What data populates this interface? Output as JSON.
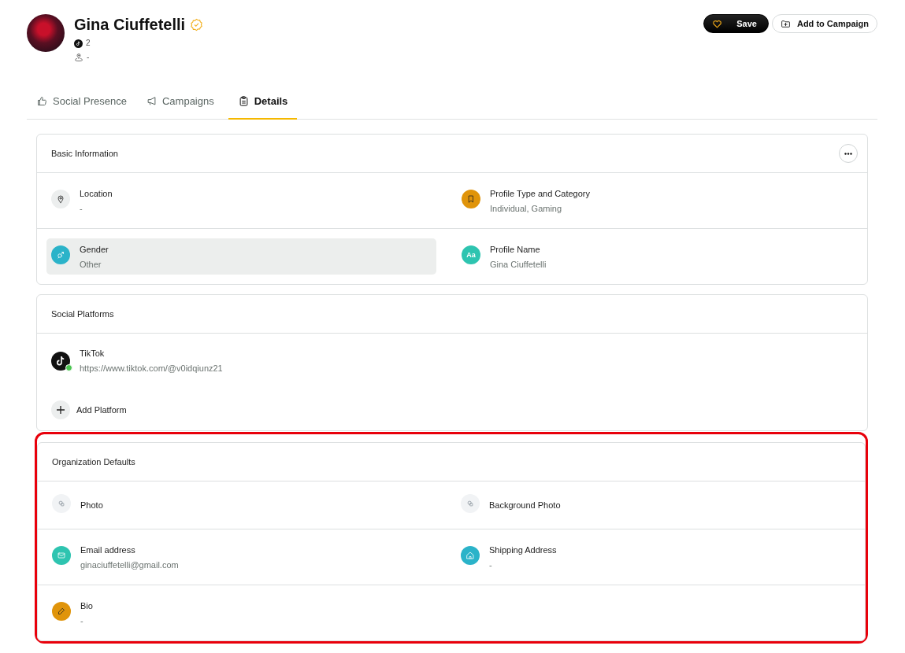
{
  "profile": {
    "name": "Gina Ciuffetelli",
    "verified": true,
    "platform_count": "2",
    "location": "-"
  },
  "actions": [
    {
      "kind": "save",
      "label": "Save"
    },
    {
      "kind": "campaign",
      "label": "Add to Campaign"
    }
  ],
  "tabs": [
    {
      "kind": "thumb",
      "label": "Social Presence",
      "selected": false
    },
    {
      "kind": "megaphone",
      "label": "Campaigns",
      "selected": false
    },
    {
      "kind": "clipboard",
      "label": "Details",
      "selected": true
    }
  ],
  "basic_information": {
    "title": "Basic Information",
    "rows": [
      [
        {
          "kind": "location",
          "label": "Location",
          "value": "-",
          "color": "#eceeee",
          "highlighted": false
        },
        {
          "kind": "bookmark",
          "label": "Profile Type and Category",
          "value": "Individual, Gaming",
          "color": "#e0940a",
          "highlighted": false
        }
      ],
      [
        {
          "kind": "gender",
          "label": "Gender",
          "value": "Other",
          "color": "#2bb3c9",
          "highlighted": true
        },
        {
          "kind": "text",
          "icon_text": "Aa",
          "label": "Profile Name",
          "value": "Gina Ciuffetelli",
          "color": "#2ec4b0",
          "highlighted": false
        }
      ]
    ]
  },
  "social_platforms": {
    "title": "Social Platforms",
    "platforms": [
      {
        "name": "TikTok",
        "url": "https://www.tiktok.com/@v0idqiunz21",
        "connected": true
      }
    ],
    "add_label": "Add Platform"
  },
  "organization_defaults": {
    "title": "Organization Defaults",
    "annotated": true,
    "rows": [
      [
        {
          "kind": "photo",
          "label": "Photo",
          "color": "#f1f3f5",
          "highlighted": false
        },
        {
          "kind": "photo",
          "label": "Background Photo",
          "color": "#f1f3f5",
          "highlighted": false
        }
      ],
      [
        {
          "kind": "email",
          "label": "Email address",
          "value": "ginaciuffetelli@gmail.com",
          "color": "#2ec4b0",
          "highlighted": false
        },
        {
          "kind": "home",
          "label": "Shipping Address",
          "value": "-",
          "color": "#2bb3c9",
          "highlighted": false
        }
      ],
      [
        {
          "kind": "pencil",
          "label": "Bio",
          "value": "-",
          "color": "#e0940a",
          "highlighted": false
        }
      ]
    ]
  }
}
